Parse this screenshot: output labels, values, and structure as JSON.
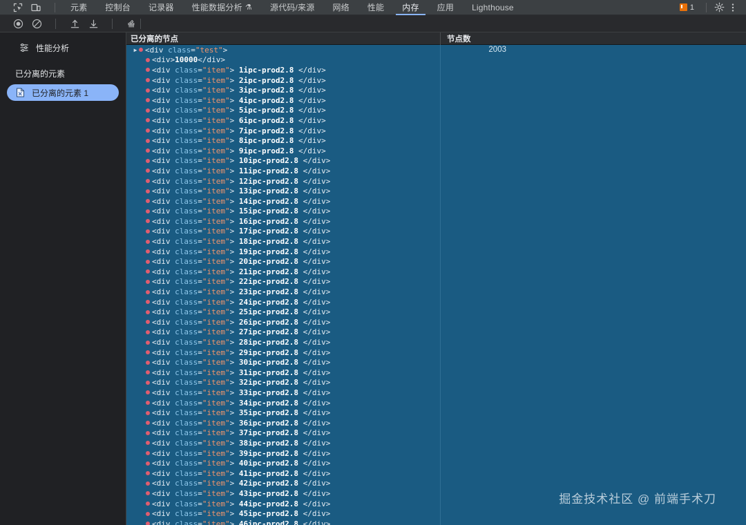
{
  "window": {
    "app": "Chrome DevTools",
    "theme_bg": "#202124",
    "accent": "#8ab4f8",
    "selection_blue": "#1a5b82"
  },
  "tabbar": {
    "icons": [
      {
        "name": "inspect-element-icon",
        "glyph": "inspect"
      },
      {
        "name": "device-toolbar-icon",
        "glyph": "device"
      }
    ],
    "tabs": [
      {
        "label": "元素",
        "active": false
      },
      {
        "label": "控制台",
        "active": false
      },
      {
        "label": "记录器",
        "active": false
      },
      {
        "label": "性能数据分析",
        "active": false,
        "suffix_icon": "flask-icon",
        "suffix_glyph": "⚗"
      },
      {
        "label": "源代码/来源",
        "active": false
      },
      {
        "label": "网络",
        "active": false
      },
      {
        "label": "性能",
        "active": false
      },
      {
        "label": "内存",
        "active": true
      },
      {
        "label": "应用",
        "active": false
      },
      {
        "label": "Lighthouse",
        "active": false
      }
    ],
    "warning_count": "1",
    "settings_icon": "gear-icon",
    "more_icon": "kebab-menu-icon"
  },
  "toolbar2": {
    "buttons": [
      {
        "name": "record-button",
        "icon": "record-circle-icon",
        "label": "Record"
      },
      {
        "name": "clear-button",
        "icon": "no-entry-icon",
        "label": "Clear"
      },
      {
        "name": "load-profile-button",
        "icon": "upload-arrow-icon",
        "label": "Load profile"
      },
      {
        "name": "save-profile-button",
        "icon": "download-arrow-icon",
        "label": "Save profile"
      },
      {
        "name": "collect-garbage-button",
        "icon": "trash-broom-icon",
        "label": "Collect garbage"
      }
    ]
  },
  "sidebar": {
    "profiles_label": "性能分析",
    "profiles_icon": "profiles-icon",
    "section_label": "已分离的元素",
    "items": [
      {
        "label": "已分离的元素 1",
        "icon": "detached-document-icon",
        "selected": true
      }
    ]
  },
  "main": {
    "columns": [
      {
        "key": "node",
        "label": "已分离的节点"
      },
      {
        "key": "count",
        "label": "节点数"
      }
    ],
    "root": {
      "expanded": false,
      "triangle": "▶",
      "tag_open": "<div",
      "attr_name": "class",
      "attr_eq": "=",
      "attr_value": "\"test\"",
      "tag_close": ">",
      "count": "2003"
    },
    "text_node": {
      "tag_open": "<div>",
      "text": "10000",
      "tag_close": "</div>"
    },
    "item_prefix": "<div",
    "item_attr_name": "class",
    "item_attr_value": "\"item\"",
    "item_gt": ">",
    "item_suffix": "ipc-prod2.8",
    "item_close": "</div>",
    "item_indices": [
      1,
      2,
      3,
      4,
      5,
      6,
      7,
      8,
      9,
      10,
      11,
      12,
      13,
      14,
      15,
      16,
      17,
      18,
      19,
      20,
      21,
      22,
      23,
      24,
      25,
      26,
      27,
      28,
      29,
      30,
      31,
      32,
      33,
      34,
      35,
      36,
      37,
      38,
      39,
      40,
      41,
      42,
      43,
      44,
      45,
      46
    ]
  },
  "watermark": {
    "text": "掘金技术社区 @ 前端手术刀"
  }
}
